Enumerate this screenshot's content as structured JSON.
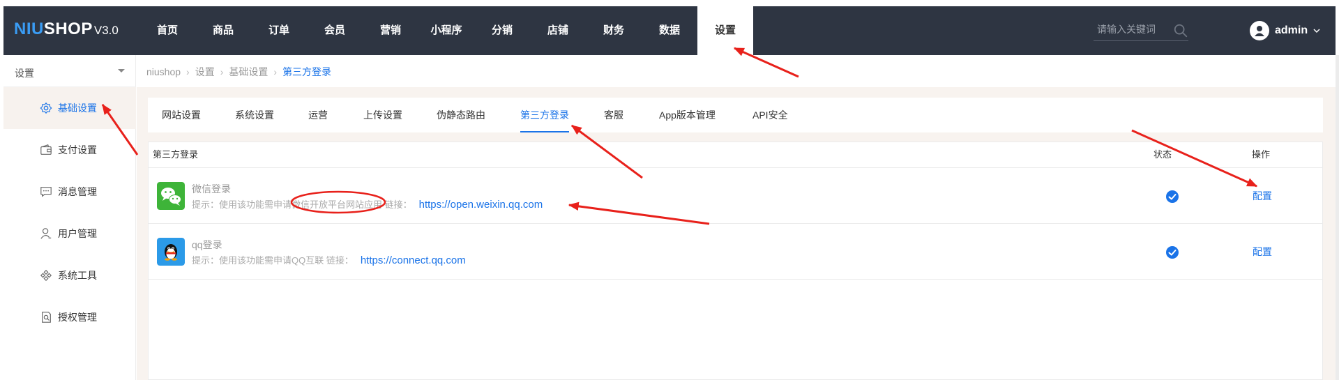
{
  "header": {
    "logo": {
      "part1": "NIU",
      "part2": "SHOP",
      "version": "V3.0"
    },
    "nav": [
      {
        "label": "首页",
        "active": false
      },
      {
        "label": "商品",
        "active": false
      },
      {
        "label": "订单",
        "active": false
      },
      {
        "label": "会员",
        "active": false
      },
      {
        "label": "营销",
        "active": false
      },
      {
        "label": "小程序",
        "active": false
      },
      {
        "label": "分销",
        "active": false
      },
      {
        "label": "店铺",
        "active": false
      },
      {
        "label": "财务",
        "active": false
      },
      {
        "label": "数据",
        "active": false
      },
      {
        "label": "设置",
        "active": true
      }
    ],
    "search": {
      "placeholder": "请输入关键词",
      "icon": "search-icon"
    },
    "user": {
      "name": "admin",
      "icon": "user-avatar-icon"
    }
  },
  "sidebar": {
    "title": "设置",
    "items": [
      {
        "label": "基础设置",
        "icon": "gear-icon",
        "active": true
      },
      {
        "label": "支付设置",
        "icon": "wallet-icon",
        "active": false
      },
      {
        "label": "消息管理",
        "icon": "message-icon",
        "active": false
      },
      {
        "label": "用户管理",
        "icon": "user-icon",
        "active": false
      },
      {
        "label": "系统工具",
        "icon": "tools-icon",
        "active": false
      },
      {
        "label": "授权管理",
        "icon": "license-icon",
        "active": false
      }
    ]
  },
  "breadcrumb": [
    "niushop",
    "设置",
    "基础设置",
    "第三方登录"
  ],
  "tabs": [
    {
      "label": "网站设置",
      "active": false
    },
    {
      "label": "系统设置",
      "active": false
    },
    {
      "label": "运营",
      "active": false
    },
    {
      "label": "上传设置",
      "active": false
    },
    {
      "label": "伪静态路由",
      "active": false
    },
    {
      "label": "第三方登录",
      "active": true
    },
    {
      "label": "客服",
      "active": false
    },
    {
      "label": "App版本管理",
      "active": false
    },
    {
      "label": "API安全",
      "active": false
    }
  ],
  "table": {
    "columns": [
      "第三方登录",
      "状态",
      "操作"
    ],
    "rows": [
      {
        "name": "微信登录",
        "icon": "wechat-icon",
        "hint": "提示：使用该功能需申请微信开放平台网站应用 链接：",
        "link": "https://open.weixin.qq.com",
        "status": "enabled",
        "action": "配置"
      },
      {
        "name": "qq登录",
        "icon": "qq-icon",
        "hint": "提示：使用该功能需申请QQ互联 链接：",
        "link": "https://connect.qq.com",
        "status": "enabled",
        "action": "配置"
      }
    ]
  },
  "colors": {
    "header_bg": "#2e3542",
    "accent": "#1a73e8",
    "logo_accent": "#3a9cf4",
    "annotation": "#e8211b",
    "wechat": "#3eb439",
    "qq": "#2b9ae8"
  }
}
